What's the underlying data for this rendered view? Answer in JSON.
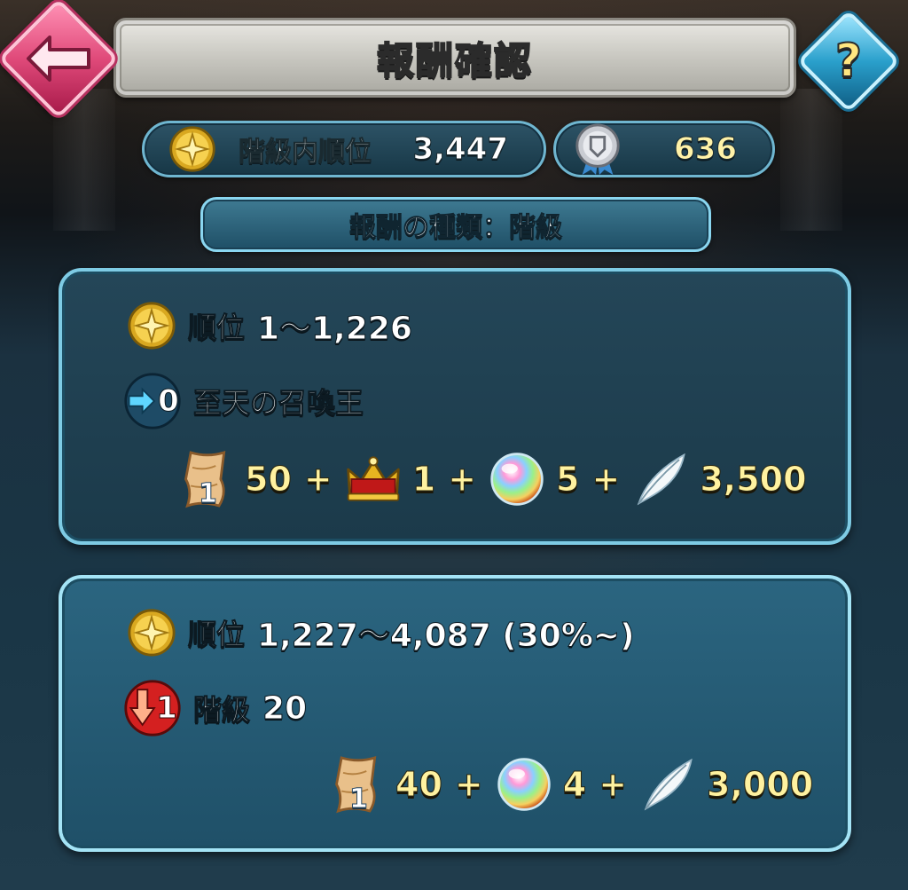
{
  "header": {
    "title": "報酬確認",
    "back_icon": "back-arrow-icon",
    "help_label": "?"
  },
  "stats": {
    "rank_label": "階級内順位",
    "rank_value": "3,447",
    "points_value": "636"
  },
  "reward_type": {
    "label": "報酬の種類：階級"
  },
  "tiers": [
    {
      "rank_label": "順位",
      "rank_range": "1～1,226",
      "change_value": "0",
      "change_text": "至天の召喚王",
      "rewards": [
        {
          "icon": "scroll-icon",
          "badge": "1",
          "value": "50",
          "plus": "+"
        },
        {
          "icon": "crown-icon",
          "value": "1",
          "plus": "+"
        },
        {
          "icon": "orb-icon",
          "value": "5",
          "plus": "+"
        },
        {
          "icon": "feather-icon",
          "value": "3,500"
        }
      ]
    },
    {
      "rank_label": "順位",
      "rank_range": "1,227～4,087 (30%~)",
      "change_value": "1",
      "change_label": "階級",
      "change_text": "20",
      "rewards": [
        {
          "icon": "scroll-icon",
          "badge": "1",
          "value": "40",
          "plus": "+"
        },
        {
          "icon": "orb-icon",
          "value": "4",
          "plus": "+"
        },
        {
          "icon": "feather-icon",
          "value": "3,000"
        }
      ]
    }
  ],
  "colors": {
    "back_button": "#e04a7a",
    "help_button": "#2aa0cc",
    "reward_value": "#fff2a0",
    "card_border": "#7ecbe4"
  }
}
